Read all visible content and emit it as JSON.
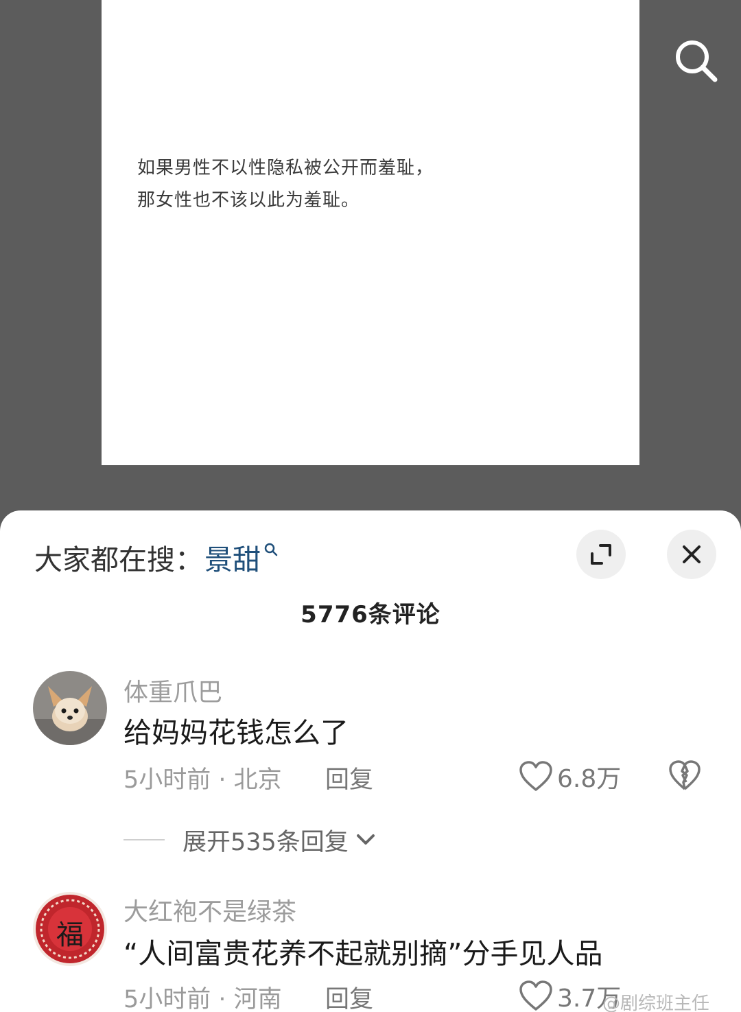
{
  "post": {
    "lines": [
      "如果男性不以性隐私被公开而羞耻，",
      "那女性也不该以此为羞耻。"
    ]
  },
  "icons": {
    "search": "search-icon",
    "expand": "expand-icon",
    "close": "close-icon",
    "like": "heart-icon",
    "dislike": "broken-heart-icon"
  },
  "trending": {
    "label": "大家都在搜：",
    "keyword": "景甜"
  },
  "comments_header": {
    "count_label": "5776条评论"
  },
  "comments": [
    {
      "username": "体重爪巴",
      "text": "给妈妈花钱怎么了",
      "meta": "5小时前 · 北京",
      "reply_label": "回复",
      "likes": "6.8万",
      "expand_replies": "展开535条回复"
    },
    {
      "username": "大红袍不是绿茶",
      "text": "“人间富贵花养不起就别摘”分手见人品",
      "meta": "5小时前 · 河南",
      "reply_label": "回复",
      "likes": "3.7万",
      "avatar_char": "福"
    }
  ],
  "watermark": "@剧综班主任",
  "colors": {
    "overlay": "#5c5c5c",
    "keyword": "#1f4f7a",
    "avatar_red": "#c0262c"
  }
}
